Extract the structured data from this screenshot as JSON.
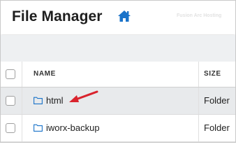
{
  "header": {
    "title": "File Manager",
    "home_icon": "home-icon",
    "watermark": "Fusion Arc Hosting"
  },
  "table": {
    "columns": [
      "NAME",
      "SIZE"
    ],
    "rows": [
      {
        "name": "html",
        "size": "Folder",
        "icon": "folder-icon",
        "highlighted": true
      },
      {
        "name": "iworx-backup",
        "size": "Folder",
        "icon": "folder-icon",
        "highlighted": false
      }
    ]
  },
  "annotation": {
    "icon": "red-arrow-icon",
    "color": "#d9232d"
  },
  "colors": {
    "accent": "#1a73c9",
    "header_band": "#eef0f2",
    "row_highlight": "#e8eaec"
  }
}
